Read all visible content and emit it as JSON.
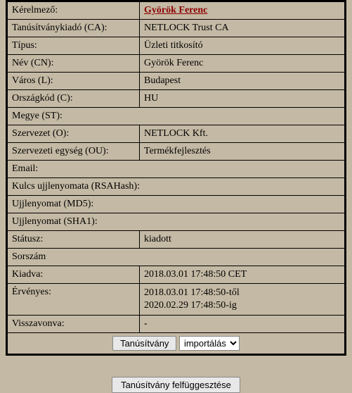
{
  "fields": {
    "requester_label": "Kérelmező:",
    "requester_value": "Györök Ferenc",
    "issuer_label": "Tanúsítványkiadó (CA):",
    "issuer_value": "NETLOCK Trust CA",
    "type_label": "Típus:",
    "type_value": "Üzleti titkosító",
    "cn_label": "Név (CN):",
    "cn_value": "Györök Ferenc",
    "city_label": "Város (L):",
    "city_value": "Budapest",
    "country_label": "Országkód (C):",
    "country_value": "HU",
    "state_label": "Megye (ST):",
    "state_value": "",
    "org_label": "Szervezet (O):",
    "org_value": "NETLOCK Kft.",
    "orgunit_label": "Szervezeti egység (OU):",
    "orgunit_value": "Termékfejlesztés",
    "email_label": "Email:",
    "email_value": "",
    "rsahash_label": "Kulcs ujjlenyomata (RSAHash):",
    "rsahash_value": "",
    "md5_label": "Ujjlenyomat (MD5):",
    "md5_value": "",
    "sha1_label": "Ujjlenyomat (SHA1):",
    "sha1_value": "",
    "status_label": "Státusz:",
    "status_value": "kiadott",
    "serial_label": "Sorszám",
    "serial_value": "",
    "issued_label": "Kiadva:",
    "issued_value": "2018.03.01 17:48:50 CET",
    "valid_label": "Érvényes:",
    "valid_line1": "2018.03.01 17:48:50-től",
    "valid_line2": "2020.02.29 17:48:50-ig",
    "revoked_label": "Visszavonva:",
    "revoked_value": "-"
  },
  "actions": {
    "cert_button": "Tanúsítvány",
    "action_selected": "importálás",
    "suspend_button": "Tanúsítvány felfüggesztése"
  }
}
